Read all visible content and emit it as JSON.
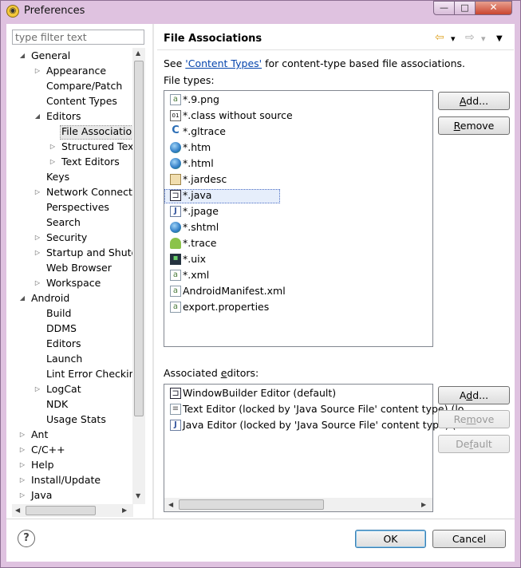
{
  "window": {
    "title": "Preferences",
    "app_icon": "eclipse-icon",
    "controls": {
      "minimize": "—",
      "maximize": "□",
      "close": "✕"
    }
  },
  "filter": {
    "placeholder": "type filter text"
  },
  "tree": [
    {
      "label": "General",
      "level": 0,
      "expander": "expanded"
    },
    {
      "label": "Appearance",
      "level": 1,
      "expander": "collapsed"
    },
    {
      "label": "Compare/Patch",
      "level": 1,
      "expander": "none"
    },
    {
      "label": "Content Types",
      "level": 1,
      "expander": "none"
    },
    {
      "label": "Editors",
      "level": 1,
      "expander": "expanded"
    },
    {
      "label": "File Associations",
      "level": 2,
      "expander": "none",
      "selected": true
    },
    {
      "label": "Structured Text",
      "level": 2,
      "expander": "collapsed"
    },
    {
      "label": "Text Editors",
      "level": 2,
      "expander": "collapsed"
    },
    {
      "label": "Keys",
      "level": 1,
      "expander": "none"
    },
    {
      "label": "Network Connections",
      "level": 1,
      "expander": "collapsed"
    },
    {
      "label": "Perspectives",
      "level": 1,
      "expander": "none"
    },
    {
      "label": "Search",
      "level": 1,
      "expander": "none"
    },
    {
      "label": "Security",
      "level": 1,
      "expander": "collapsed"
    },
    {
      "label": "Startup and Shutdown",
      "level": 1,
      "expander": "collapsed"
    },
    {
      "label": "Web Browser",
      "level": 1,
      "expander": "none"
    },
    {
      "label": "Workspace",
      "level": 1,
      "expander": "collapsed"
    },
    {
      "label": "Android",
      "level": 0,
      "expander": "expanded"
    },
    {
      "label": "Build",
      "level": 1,
      "expander": "none"
    },
    {
      "label": "DDMS",
      "level": 1,
      "expander": "none"
    },
    {
      "label": "Editors",
      "level": 1,
      "expander": "none"
    },
    {
      "label": "Launch",
      "level": 1,
      "expander": "none"
    },
    {
      "label": "Lint Error Checking",
      "level": 1,
      "expander": "none"
    },
    {
      "label": "LogCat",
      "level": 1,
      "expander": "collapsed"
    },
    {
      "label": "NDK",
      "level": 1,
      "expander": "none"
    },
    {
      "label": "Usage Stats",
      "level": 1,
      "expander": "none"
    },
    {
      "label": "Ant",
      "level": 0,
      "expander": "collapsed"
    },
    {
      "label": "C/C++",
      "level": 0,
      "expander": "collapsed"
    },
    {
      "label": "Help",
      "level": 0,
      "expander": "collapsed"
    },
    {
      "label": "Install/Update",
      "level": 0,
      "expander": "collapsed"
    },
    {
      "label": "Java",
      "level": 0,
      "expander": "collapsed"
    }
  ],
  "page": {
    "title": "File Associations",
    "see_prefix": "See ",
    "content_types_link": "'Content Types'",
    "see_suffix": " for content-type based file associations.",
    "file_types_label": "File types:",
    "associated_editors_label": "Associated editors:"
  },
  "file_types": [
    {
      "label": "*.9.png",
      "icon": "generic-file-icon"
    },
    {
      "label": "*.class without source",
      "icon": "class-file-icon"
    },
    {
      "label": "*.gltrace",
      "icon": "gltrace-icon"
    },
    {
      "label": "*.htm",
      "icon": "globe-icon"
    },
    {
      "label": "*.html",
      "icon": "globe-icon"
    },
    {
      "label": "*.jardesc",
      "icon": "jar-icon"
    },
    {
      "label": "*.java",
      "icon": "windowbuilder-icon",
      "selected": true
    },
    {
      "label": "*.jpage",
      "icon": "java-file-icon"
    },
    {
      "label": "*.shtml",
      "icon": "globe-icon"
    },
    {
      "label": "*.trace",
      "icon": "android-icon"
    },
    {
      "label": "*.uix",
      "icon": "uix-icon"
    },
    {
      "label": "*.xml",
      "icon": "generic-file-icon"
    },
    {
      "label": "AndroidManifest.xml",
      "icon": "generic-file-icon"
    },
    {
      "label": "export.properties",
      "icon": "generic-file-icon"
    }
  ],
  "associated_editors": [
    {
      "label": "WindowBuilder Editor (default)",
      "icon": "windowbuilder-icon"
    },
    {
      "label": "Text Editor (locked by 'Java Source File' content type) (lo",
      "icon": "text-file-icon"
    },
    {
      "label": "Java Editor (locked by 'Java Source File' content type) (lo",
      "icon": "java-file-icon"
    }
  ],
  "buttons": {
    "add_file_type": {
      "mnemonic": "A",
      "rest": "dd..."
    },
    "remove_file_type": {
      "mnemonic": "R",
      "rest": "emove"
    },
    "add_editor": {
      "pre": "A",
      "mnemonic": "d",
      "rest": "d..."
    },
    "remove_editor": {
      "pre": "Re",
      "mnemonic": "m",
      "rest": "ove"
    },
    "default_editor": {
      "pre": "De",
      "mnemonic": "f",
      "rest": "ault"
    },
    "ok": "OK",
    "cancel": "Cancel",
    "help": "?"
  },
  "nav": {
    "back": "⇦",
    "forward": "⇨",
    "dropdown": "▾",
    "menu": "▼"
  }
}
